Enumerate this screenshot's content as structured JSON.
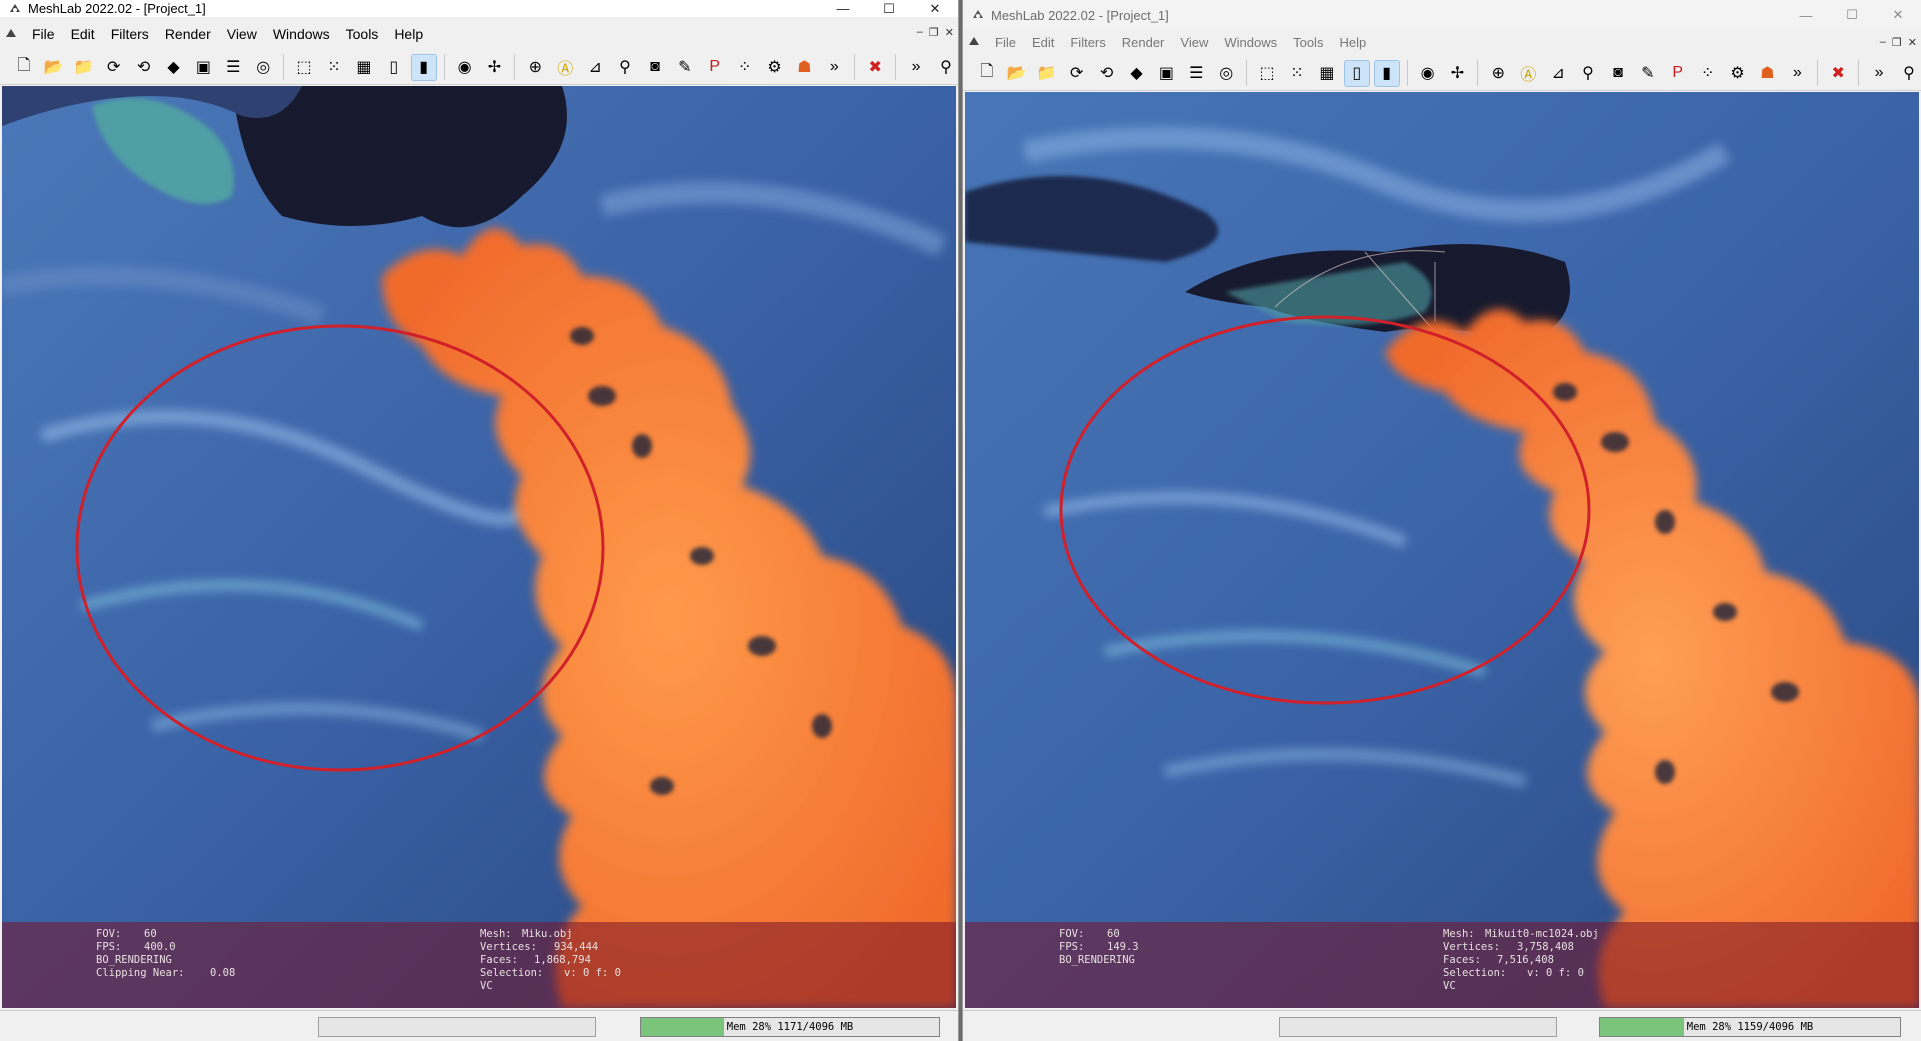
{
  "left_window": {
    "title": "MeshLab 2022.02 - [Project_1]",
    "menu": [
      "File",
      "Edit",
      "Filters",
      "Render",
      "View",
      "Windows",
      "Tools",
      "Help"
    ],
    "info_left": [
      {
        "key": "FOV:",
        "value": "60"
      },
      {
        "key": "FPS:",
        "value": "400.0"
      },
      {
        "key": "BO_RENDERING",
        "value": ""
      },
      {
        "key": "Clipping Near:",
        "value": "0.08"
      }
    ],
    "info_right": [
      {
        "key": "Mesh:",
        "value": "Miku.obj"
      },
      {
        "key": "Vertices:",
        "value": "934,444"
      },
      {
        "key": "Faces:",
        "value": "1,868,794"
      },
      {
        "key": "Selection:",
        "value": "v: 0 f: 0"
      },
      {
        "key": "VC",
        "value": ""
      }
    ],
    "memory": {
      "text": "Mem 28% 1171/4096 MB",
      "fraction": 0.28
    }
  },
  "right_window": {
    "title": "MeshLab 2022.02 - [Project_1]",
    "menu": [
      "File",
      "Edit",
      "Filters",
      "Render",
      "View",
      "Windows",
      "Tools",
      "Help"
    ],
    "info_left": [
      {
        "key": "FOV:",
        "value": "60"
      },
      {
        "key": "FPS:",
        "value": "149.3"
      },
      {
        "key": "BO_RENDERING",
        "value": ""
      }
    ],
    "info_right": [
      {
        "key": "Mesh:",
        "value": "Mikuit0-mc1024.obj"
      },
      {
        "key": "Vertices:",
        "value": "3,758,408"
      },
      {
        "key": "Faces:",
        "value": "7,516,408"
      },
      {
        "key": "Selection:",
        "value": "v: 0 f: 0"
      },
      {
        "key": "VC",
        "value": ""
      }
    ],
    "memory": {
      "text": "Mem 28% 1159/4096 MB",
      "fraction": 0.28
    }
  },
  "toolbar_icons": [
    "new-project-icon",
    "open-project-icon",
    "open-mesh-icon",
    "reload-icon",
    "reload-all-icon",
    "save-icon",
    "snapshot-icon",
    "layers-icon",
    "raster-icon",
    "bbox-icon",
    "points-icon",
    "wireframe-icon",
    "flat-icon",
    "smooth-icon",
    "light-icon",
    "axis-icon",
    "trackball-icon",
    "annotation-icon",
    "measure-icon",
    "select-icon",
    "camera-icon",
    "paint-icon",
    "pick-points-icon",
    "align-icon",
    "reference-icon",
    "texture-icon",
    "more-icon",
    "delete-icon",
    "more2-icon",
    "search-icon"
  ],
  "colors": {
    "highlight_ellipse": "#d0202a",
    "coral": "#ff8a3a",
    "rock_blue": "#3f68a8"
  }
}
